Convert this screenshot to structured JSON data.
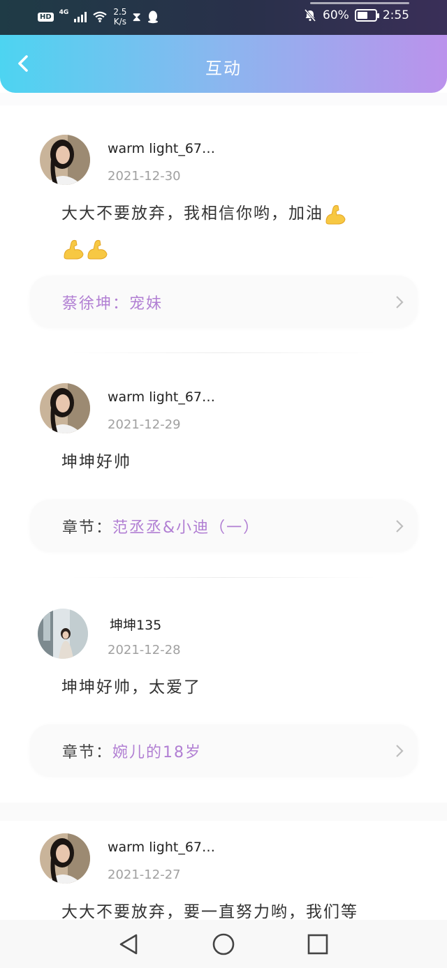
{
  "status_bar": {
    "hd": "HD",
    "network": "4G",
    "speed_value": "2.5",
    "speed_unit": "K/s",
    "battery_percent": "60%",
    "battery_level": 0.6,
    "time": "2:55"
  },
  "header": {
    "title": "互动"
  },
  "posts": [
    {
      "username": "warm light_67…",
      "date": "2021-12-30",
      "text": "大大不要放弃，我相信你哟，加油",
      "emoji": [
        "flexed-biceps",
        "flexed-biceps",
        "flexed-biceps"
      ],
      "chapter_prefix": "蔡徐坤：",
      "chapter_name": "宠妹"
    },
    {
      "username": "warm light_67…",
      "date": "2021-12-29",
      "text": "坤坤好帅",
      "chapter_prefix": "章节：",
      "chapter_name": "范丞丞&小迪（一）"
    },
    {
      "username": "坤坤135",
      "date": "2021-12-28",
      "text": "坤坤好帅，太爱了",
      "chapter_prefix": "章节：",
      "chapter_name": "婉儿的18岁"
    },
    {
      "username": "warm light_67…",
      "date": "2021-12-27",
      "text": "大大不要放弃，要一直努力哟，我们等"
    }
  ],
  "colors": {
    "header_start": "#4dd4f1",
    "header_end": "#bb92ec",
    "chapter_accent": "#b17fd3"
  }
}
